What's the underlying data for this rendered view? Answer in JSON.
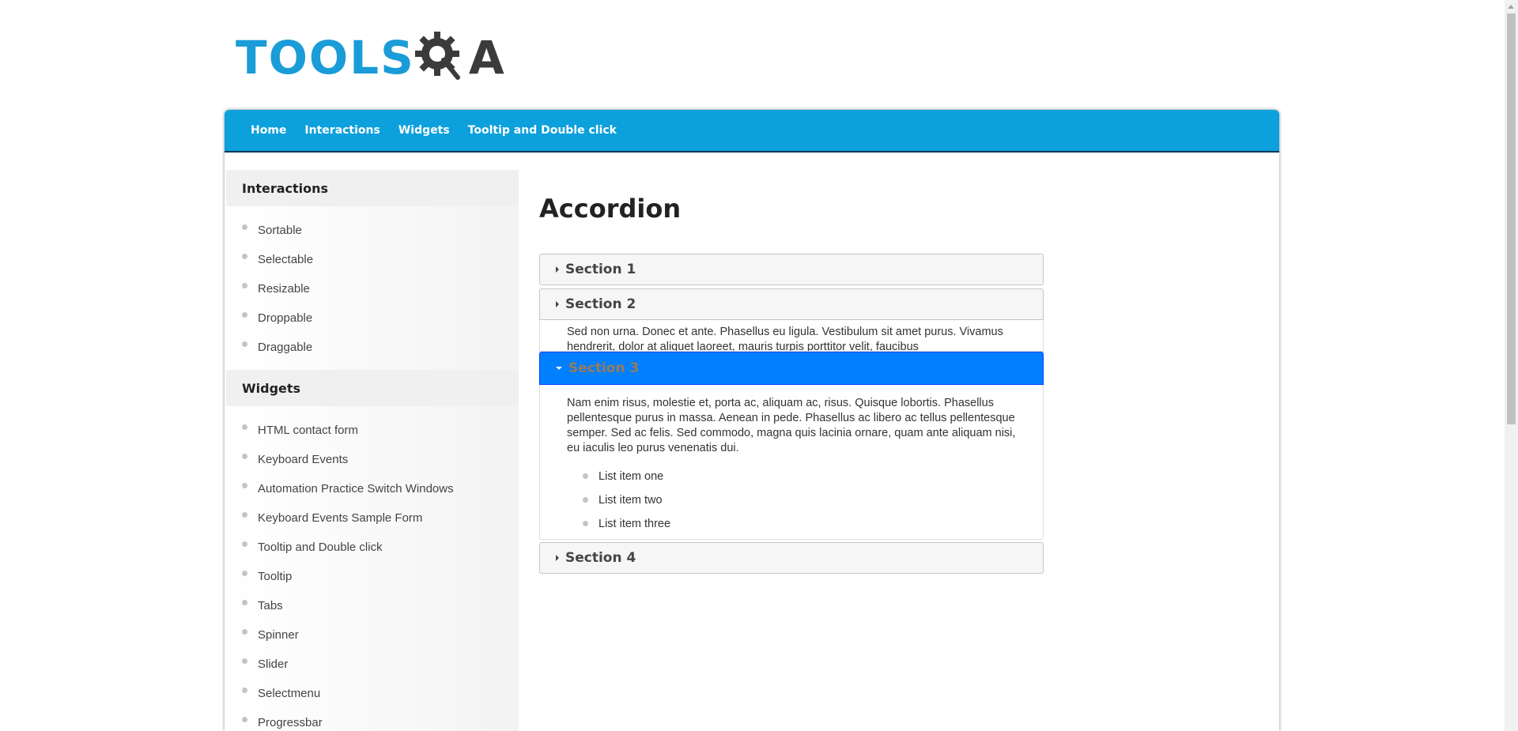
{
  "logo": {
    "part1": "TOOLS",
    "part2": "A"
  },
  "nav": {
    "items": [
      {
        "label": "Home"
      },
      {
        "label": "Interactions"
      },
      {
        "label": "Widgets"
      },
      {
        "label": "Tooltip and Double click"
      }
    ]
  },
  "sidebar": {
    "interactions": {
      "heading": "Interactions",
      "items": [
        "Sortable",
        "Selectable",
        "Resizable",
        "Droppable",
        "Draggable"
      ]
    },
    "widgets": {
      "heading": "Widgets",
      "items": [
        "HTML contact form",
        "Keyboard Events",
        "Automation Practice Switch Windows",
        "Keyboard Events Sample Form",
        "Tooltip and Double click",
        "Tooltip",
        "Tabs",
        "Spinner",
        "Slider",
        "Selectmenu",
        "Progressbar"
      ]
    }
  },
  "main": {
    "title": "Accordion",
    "sections": [
      {
        "label": "Section 1",
        "state": "collapsed"
      },
      {
        "label": "Section 2",
        "state": "collapsing",
        "text": "Sed non urna. Donec et ante. Phasellus eu ligula. Vestibulum sit amet purus. Vivamus hendrerit, dolor at aliquet laoreet, mauris turpis porttitor velit, faucibus"
      },
      {
        "label": "Section 3",
        "state": "active",
        "text": "Nam enim risus, molestie et, porta ac, aliquam ac, risus. Quisque lobortis. Phasellus pellentesque purus in massa. Aenean in pede. Phasellus ac libero ac tellus pellentesque semper. Sed ac felis. Sed commodo, magna quis lacinia ornare, quam ante aliquam nisi, eu iaculis leo purus venenatis dui.",
        "list": [
          "List item one",
          "List item two",
          "List item three"
        ]
      },
      {
        "label": "Section 4",
        "state": "collapsed"
      }
    ]
  },
  "colors": {
    "brand_blue": "#0ca0dc",
    "active_header": "#007fff"
  }
}
